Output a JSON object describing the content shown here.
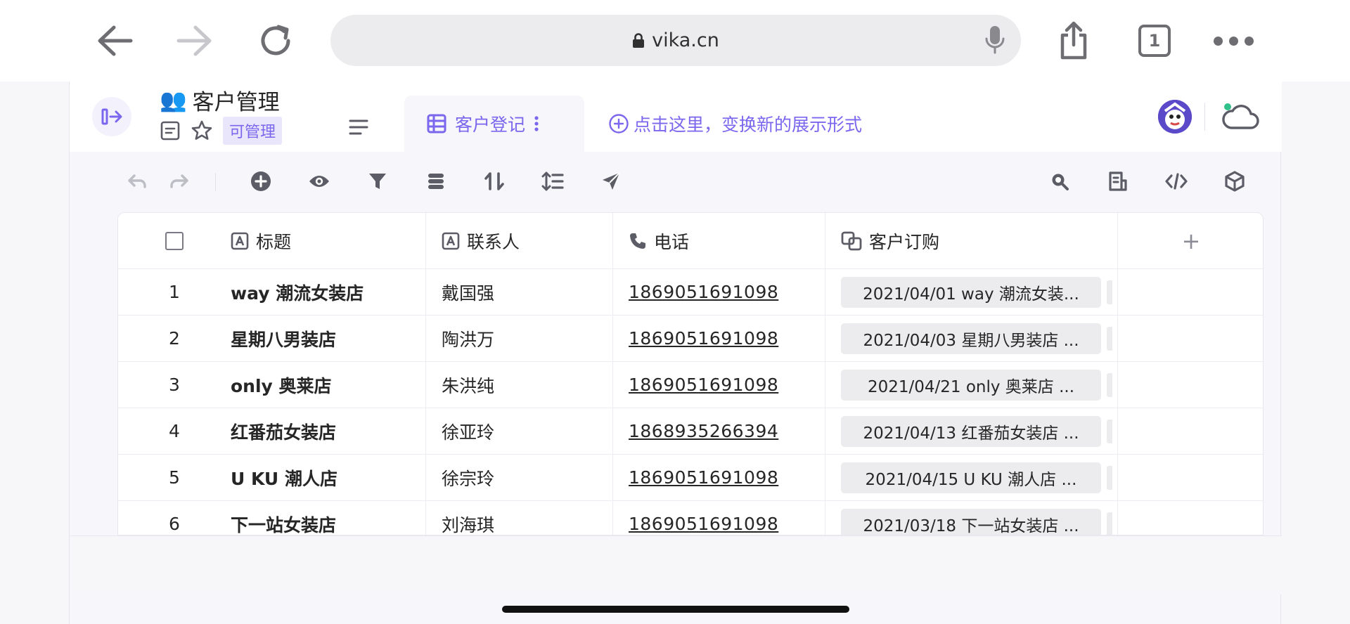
{
  "browser": {
    "url": "vika.cn",
    "tabs_count": "1"
  },
  "header": {
    "title_emoji": "👥",
    "title": "客户管理",
    "permission_badge": "可管理",
    "view_tab_label": "客户登记",
    "add_view_label": "点击这里，变换新的展示形式"
  },
  "grid": {
    "columns": [
      {
        "label": "标题",
        "icon": "text-field-icon"
      },
      {
        "label": "联系人",
        "icon": "text-field-icon"
      },
      {
        "label": "电话",
        "icon": "phone-icon"
      },
      {
        "label": "客户订购",
        "icon": "link-icon"
      }
    ],
    "add_column_label": "+",
    "rows": [
      {
        "index": "1",
        "title": "way 潮流女装店",
        "contact": "戴国强",
        "phone": "1869051691098",
        "order": "2021/04/01 way 潮流女装..."
      },
      {
        "index": "2",
        "title": "星期八男装店",
        "contact": "陶洪万",
        "phone": "1869051691098",
        "order": "2021/04/03 星期八男装店 ..."
      },
      {
        "index": "3",
        "title": "only 奥莱店",
        "contact": "朱洪纯",
        "phone": "1869051691098",
        "order": "2021/04/21 only 奥莱店 ..."
      },
      {
        "index": "4",
        "title": "红番茄女装店",
        "contact": "徐亚玲",
        "phone": "1868935266394",
        "order": "2021/04/13 红番茄女装店 ..."
      },
      {
        "index": "5",
        "title": "U KU 潮人店",
        "contact": "徐宗玲",
        "phone": "1869051691098",
        "order": "2021/04/15 U KU 潮人店 ..."
      },
      {
        "index": "6",
        "title": "下一站女装店",
        "contact": "刘海琪",
        "phone": "1869051691098",
        "order": "2021/03/18 下一站女装店 ..."
      }
    ]
  },
  "colors": {
    "accent": "#7b67ee",
    "icon_gray": "#5c5c66",
    "disabled": "#bdbdc6"
  }
}
